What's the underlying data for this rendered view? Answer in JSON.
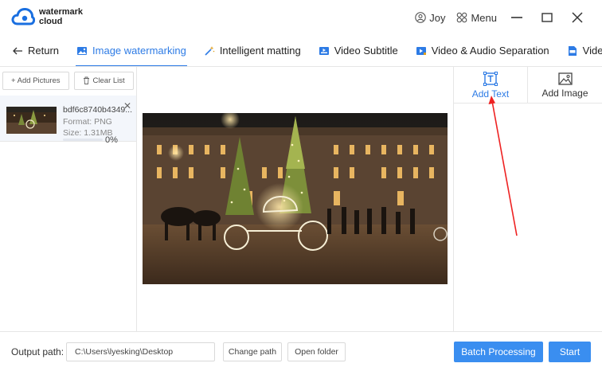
{
  "app": {
    "brand_line1": "watermark",
    "brand_line2": "cloud"
  },
  "titlebar": {
    "user": "Joy",
    "menu": "Menu"
  },
  "tabs": [
    {
      "label": "Return",
      "icon": "arrow-left-icon"
    },
    {
      "label": "Image watermarking",
      "icon": "image-icon",
      "active": true
    },
    {
      "label": "Intelligent matting",
      "icon": "magic-wand-icon"
    },
    {
      "label": "Video Subtitle",
      "icon": "video-subtitle-icon"
    },
    {
      "label": "Video & Audio Separation",
      "icon": "video-audio-icon"
    },
    {
      "label": "Video Form",
      "icon": "video-format-icon"
    }
  ],
  "left_panel": {
    "add_pictures": "+ Add Pictures",
    "clear_list": "Clear List",
    "file": {
      "name": "bdf6c8740b4349...",
      "format": "Format:  PNG",
      "size": "Size:  1.31MB",
      "progress_text": "0%",
      "progress": 0
    }
  },
  "right_panel": {
    "add_text": "Add Text",
    "add_image": "Add Image"
  },
  "bottom": {
    "output_label": "Output path:",
    "output_path": "C:\\Users\\lyesking\\Desktop",
    "change_path": "Change path",
    "open_folder": "Open folder",
    "batch": "Batch Processing",
    "start": "Start"
  },
  "colors": {
    "accent": "#2d7be5",
    "primary_button": "#3a8ef0",
    "annotation_arrow": "#ee2222"
  }
}
